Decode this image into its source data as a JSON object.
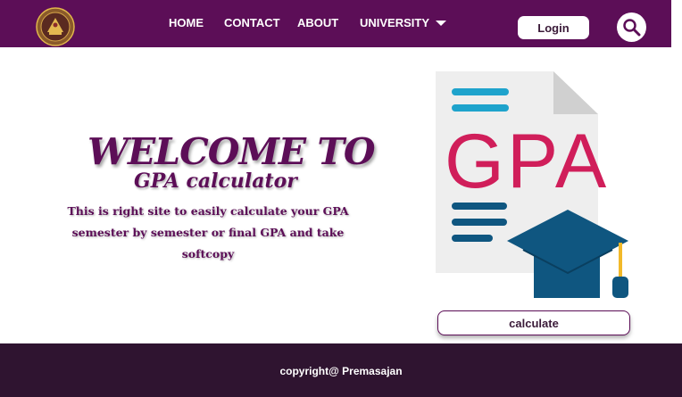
{
  "navbar": {
    "logo_icon": "university-emblem-icon",
    "links": [
      {
        "label": "HOME"
      },
      {
        "label": "CONTACT"
      },
      {
        "label": "ABOUT"
      },
      {
        "label": "UNIVERSITY",
        "icon": "caret-down-icon"
      }
    ],
    "login_label": "Login",
    "search_icon": "search-icon"
  },
  "hero": {
    "title": "WELCOME TO",
    "subtitle": "GPA calculator",
    "description": "This is right site to easily calculate your GPA semester by semester or final GPA and take softcopy"
  },
  "illustration": {
    "icon": "gpa-document-graduation-cap-icon",
    "text": "GPA"
  },
  "calculate_label": "calculate",
  "footer": {
    "text": "copyright@ Premasajan"
  },
  "colors": {
    "brand": "#5c0e57",
    "footer": "#2f1430",
    "gpa_red": "#d01e5a",
    "cap_blue": "#0f5680",
    "line_cyan": "#1ea3cc"
  }
}
